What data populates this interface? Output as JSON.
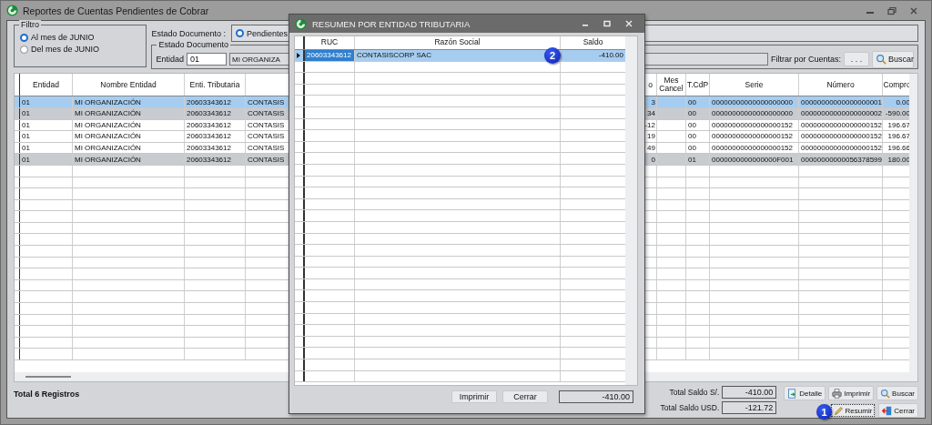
{
  "window": {
    "title": "Reportes de Cuentas Pendientes de Cobrar"
  },
  "filter": {
    "title": "Filtro",
    "options": [
      {
        "label": "Al mes de JUNIO",
        "selected": true
      },
      {
        "label": "Del mes de JUNIO",
        "selected": false
      }
    ]
  },
  "document_state": {
    "label": "Estado Documento :",
    "options": [
      {
        "label": "Pendientes",
        "selected": true
      }
    ]
  },
  "document_group": {
    "title": "Estado Documento",
    "entity_label": "Entidad",
    "entity_code": "01",
    "entity_name": "MI ORGANIZA",
    "accounts_label": "Filtrar por Cuentas:",
    "accounts_button": ". . .",
    "search_button": "Buscar"
  },
  "table": {
    "headers": [
      "Entidad",
      "Nombre Entidad",
      "Enti. Tributaria",
      "o",
      "Mes Cancel",
      "T.CdP",
      "Serie",
      "Número",
      "Compro"
    ],
    "rows": [
      {
        "selected": true,
        "shaded": false,
        "entidad": "01",
        "nombre_entidad": "MI ORGANIZACIÓN",
        "enti_tributaria": "20603343612",
        "column_4": "CONTASIS",
        "column_5": "3",
        "t_cdp": "00",
        "serie": "00000000000000000000",
        "numero": "00000000000000000001",
        "compro": "0.00"
      },
      {
        "selected": false,
        "shaded": true,
        "entidad": "01",
        "nombre_entidad": "MI ORGANIZACIÓN",
        "enti_tributaria": "20603343612",
        "column_4": "CONTASIS",
        "column_5": "34",
        "t_cdp": "00",
        "serie": "00000000000000000000",
        "numero": "00000000000000000002",
        "compro": "-590.00"
      },
      {
        "selected": false,
        "shaded": false,
        "entidad": "01",
        "nombre_entidad": "MI ORGANIZACIÓN",
        "enti_tributaria": "20603343612",
        "column_4": "CONTASIS",
        "column_5": "-12",
        "t_cdp": "00",
        "serie": "00000000000000000152",
        "numero": "00000000000000000152",
        "compro": "196.67"
      },
      {
        "selected": false,
        "shaded": false,
        "entidad": "01",
        "nombre_entidad": "MI ORGANIZACIÓN",
        "enti_tributaria": "20603343612",
        "column_4": "CONTASIS",
        "column_5": "19",
        "t_cdp": "00",
        "serie": "00000000000000000152",
        "numero": "00000000000000000152",
        "compro": "196.67"
      },
      {
        "selected": false,
        "shaded": false,
        "entidad": "01",
        "nombre_entidad": "MI ORGANIZACIÓN",
        "enti_tributaria": "20603343612",
        "column_4": "CONTASIS",
        "column_5": "49",
        "t_cdp": "00",
        "serie": "00000000000000000152",
        "numero": "00000000000000000152",
        "compro": "196.66"
      },
      {
        "selected": false,
        "shaded": true,
        "entidad": "01",
        "nombre_entidad": "MI ORGANIZACIÓN",
        "enti_tributaria": "20603343612",
        "column_4": "CONTASIS",
        "column_5": "0",
        "t_cdp": "01",
        "serie": "0000000000000000F001",
        "numero": "00000000000056378599",
        "compro": "180.00"
      }
    ]
  },
  "status": {
    "record_count": "Total 6 Registros",
    "total_pen_label": "Total Saldo S/.",
    "total_pen": "-410.00",
    "total_usd_label": "Total Saldo USD.",
    "total_usd": "-121.72"
  },
  "buttons": [
    {
      "label": "Detalle",
      "kind": "detail",
      "focused": false
    },
    {
      "label": "Imprimir",
      "kind": "print",
      "focused": false
    },
    {
      "label": "Buscar",
      "kind": "search",
      "focused": false
    },
    {
      "label": "Resumir",
      "kind": "summary",
      "focused": true
    },
    {
      "label": "Cerrar",
      "kind": "exit",
      "focused": false
    }
  ],
  "dialog": {
    "title": "RESUMEN POR ENTIDAD TRIBUTARIA",
    "headers": [
      "RUC",
      "Razón Social",
      "Saldo"
    ],
    "rows": [
      {
        "selected": true,
        "ruc": "20603343612",
        "razon_social": "CONTASISCORP SAC",
        "saldo": "-410.00"
      }
    ],
    "print_button": "Imprimir",
    "close_button": "Cerrar",
    "total": "-410.00"
  },
  "callouts": [
    {
      "number": "1"
    },
    {
      "number": "2"
    }
  ]
}
